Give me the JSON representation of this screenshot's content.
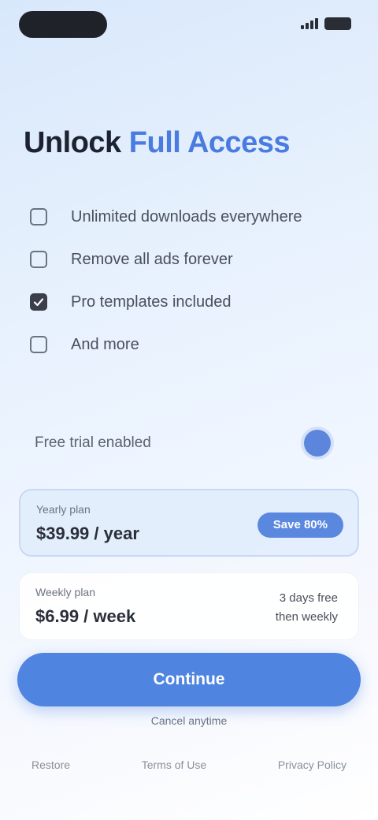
{
  "screen_title": {
    "part1": "Unlock",
    "part2": "Full Access"
  },
  "features": [
    {
      "label": "Unlimited downloads everywhere",
      "checked": false
    },
    {
      "label": "Remove all ads forever",
      "checked": false
    },
    {
      "label": "Pro templates included",
      "checked": true
    },
    {
      "label": "And more",
      "checked": false
    }
  ],
  "trial_toggle": {
    "label": "Free trial enabled",
    "enabled": true
  },
  "plans": {
    "yearly": {
      "name": "Yearly plan",
      "price": "$39.99 / year",
      "badge": "Save 80%"
    },
    "weekly": {
      "name": "Weekly plan",
      "price": "$6.99 / week",
      "side_line1": "3 days free",
      "side_line2": "then weekly"
    }
  },
  "cta_label": "Continue",
  "cancel_note": "Cancel anytime",
  "footer_links": [
    "Restore",
    "Terms of Use",
    "Privacy Policy"
  ],
  "colors": {
    "accent": "#4f84e0",
    "title_accent": "#4a7be0",
    "text": "#1c2230"
  }
}
